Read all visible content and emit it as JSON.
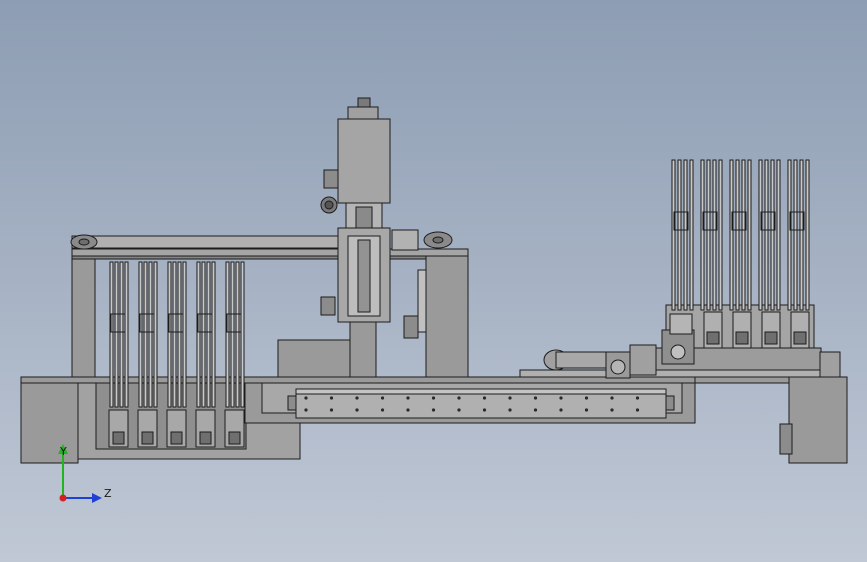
{
  "viewport": {
    "background_top": "#8d9db3",
    "background_bottom": "#c0c8d5"
  },
  "colors": {
    "part_fill": "#9a9a9a",
    "part_light": "#b4b4b4",
    "part_dark": "#7e7e7e",
    "edge": "#1c1c1c",
    "rod_fill": "#c9c9c9"
  },
  "triad": {
    "y_label": "Y",
    "z_label": "Z",
    "y_color": "#1fb51f",
    "z_color": "#1f3fd6",
    "x_color": "#d61f1f"
  }
}
